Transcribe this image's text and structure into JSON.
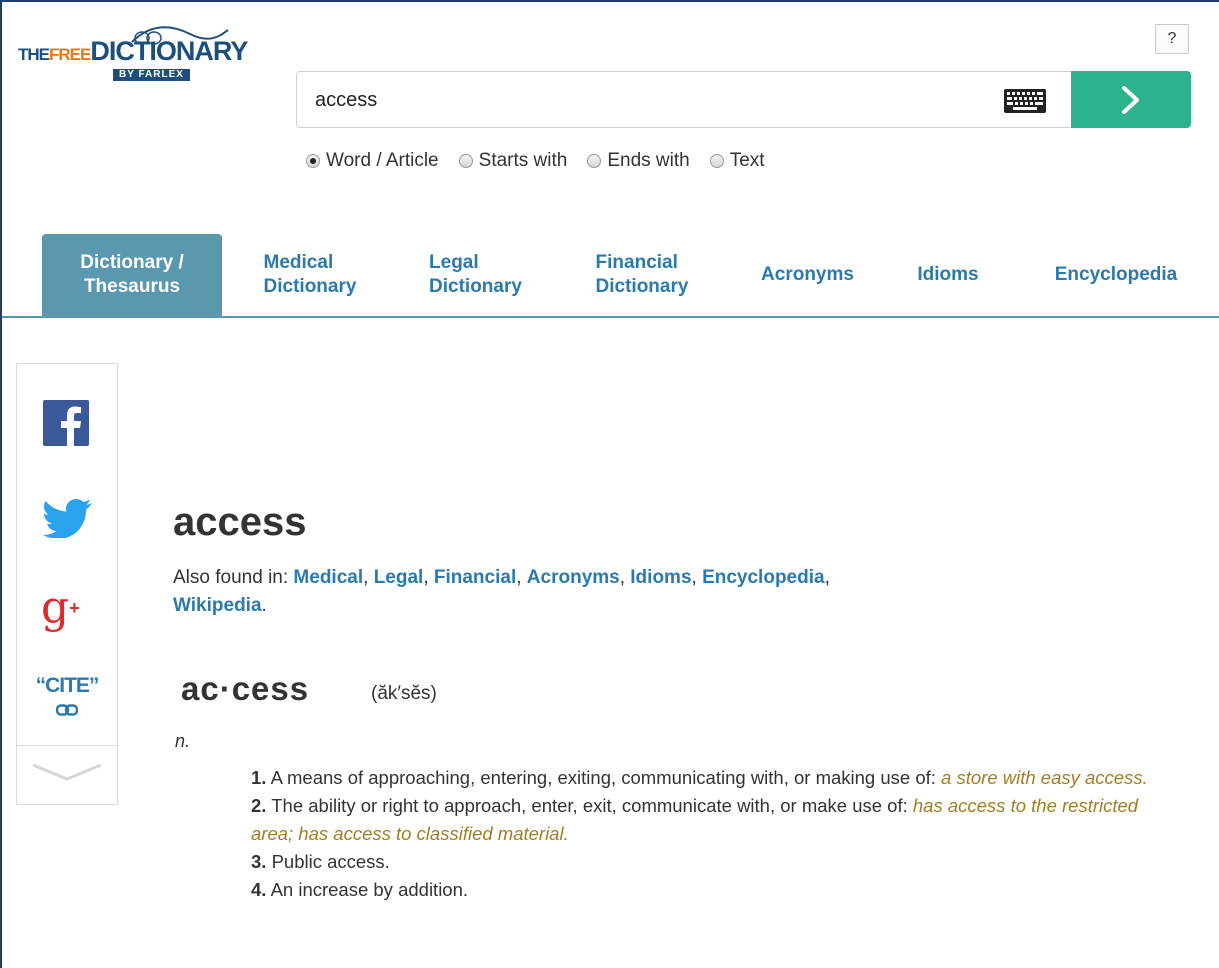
{
  "logo": {
    "the": "THE",
    "free": "FREE",
    "dictionary": "DICTIONARY",
    "by": "BY FARLEX"
  },
  "help": {
    "label": "?"
  },
  "search": {
    "value": "access",
    "button_icon": "chevron-right-icon",
    "keyboard_icon": "keyboard-icon"
  },
  "search_options": [
    {
      "label": "Word / Article",
      "checked": true
    },
    {
      "label": "Starts with",
      "checked": false
    },
    {
      "label": "Ends with",
      "checked": false
    },
    {
      "label": "Text",
      "checked": false
    }
  ],
  "tabs": [
    {
      "line1": "Dictionary /",
      "line2": "Thesaurus",
      "active": true
    },
    {
      "line1": "Medical",
      "line2": "Dictionary",
      "active": false
    },
    {
      "line1": "Legal",
      "line2": "Dictionary",
      "active": false
    },
    {
      "line1": "Financial",
      "line2": "Dictionary",
      "active": false
    },
    {
      "line1": "Acronyms",
      "line2": "",
      "active": false
    },
    {
      "line1": "Idioms",
      "line2": "",
      "active": false
    },
    {
      "line1": "Encyclopedia",
      "line2": "",
      "active": false
    }
  ],
  "share": {
    "facebook_icon": "facebook-icon",
    "twitter_icon": "twitter-icon",
    "gplus_icon": "google-plus-icon",
    "cite": "“CITE”"
  },
  "entry": {
    "headword": "access",
    "also_found_prefix": "Also found in:",
    "also_found": [
      "Medical",
      "Legal",
      "Financial",
      "Acronyms",
      "Idioms",
      "Encyclopedia",
      "Wikipedia"
    ],
    "syllabified": "ac·cess",
    "pronunciation": "(ăk′sĕs)",
    "part_of_speech": "n.",
    "senses": [
      {
        "num": "1.",
        "text": "A means of approaching, entering, exiting, communicating with, or making use of:",
        "example": "a store with easy access"
      },
      {
        "num": "2.",
        "text": "The ability or right to approach, enter, exit, communicate with, or make use of:",
        "example": "has access to the restricted area; has access to classified material"
      },
      {
        "num": "3.",
        "text": "Public access.",
        "example": ""
      },
      {
        "num": "4.",
        "text": "An increase by addition.",
        "example": ""
      }
    ]
  },
  "colors": {
    "accent": "#2a7ab0",
    "tab_active": "#5b97ad",
    "search_button": "#2cb38e",
    "example": "#a37e21",
    "logo_orange": "#e47a19",
    "logo_blue": "#1c4e7e"
  }
}
